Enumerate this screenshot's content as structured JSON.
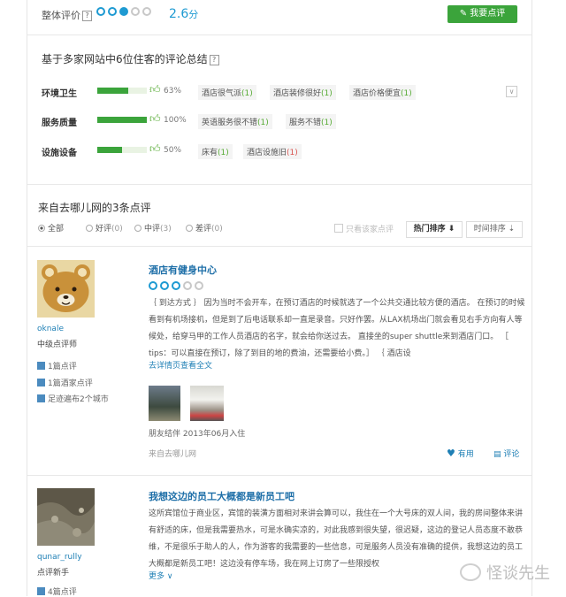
{
  "rating": {
    "label": "整体评价",
    "help": "?",
    "score": "2.6",
    "unit": "分",
    "stars_filled": 2.5,
    "stars_total": 5,
    "write_review_button": "我要点评"
  },
  "summary": {
    "title": "基于多家网站中6位住客的评论总结",
    "help": "?",
    "categories": [
      {
        "name": "环境卫生",
        "percent_text": "63%",
        "percent": 63,
        "tags": [
          {
            "text": "酒店很气派",
            "count": "(1)"
          },
          {
            "text": "酒店装修很好",
            "count": "(1)"
          },
          {
            "text": "酒店价格便宜",
            "count": "(1)"
          }
        ]
      },
      {
        "name": "服务质量",
        "percent_text": "100%",
        "percent": 100,
        "tags": [
          {
            "text": "英语服务很不错",
            "count": "(1)"
          },
          {
            "text": "服务不错",
            "count": "(1)"
          }
        ]
      },
      {
        "name": "设施设备",
        "percent_text": "50%",
        "percent": 50,
        "tags": [
          {
            "text": "床有",
            "count": "(1)"
          },
          {
            "text": "酒店设施旧",
            "count": "(1)"
          }
        ]
      }
    ]
  },
  "reviews_section": {
    "title": "来自去哪儿网的3条点评",
    "filters": [
      {
        "label": "全部",
        "count": ""
      },
      {
        "label": "好评",
        "count": "(0)"
      },
      {
        "label": "中评",
        "count": "(3)"
      },
      {
        "label": "差评",
        "count": "(0)"
      }
    ],
    "only_checkbox": "只看该家点评",
    "sort_hot": "热门排序",
    "sort_time": "时间排序"
  },
  "reviews": [
    {
      "username": "oknale",
      "level": "中级点评师",
      "stats": [
        "1篇点评",
        "1篇酒家点评",
        "足迹遍布2个城市"
      ],
      "title": "酒店有健身中心",
      "rating": 3,
      "text": "｛ 到达方式 ｝ 因为当时不会开车，在预订酒店的时候就选了一个公共交通比较方便的酒店。 在预订的时候看到有机场接机，但是到了后电话联系却一直是录音。只好作罢。从LAX机场出门就会看见右手方向有人等候处，给穿马甲的工作人员酒店的名字，就会给你送过去。 直接坐的super shuttle来到酒店门口。 ［ tips：可以直接在预订，除了到目的地的费油，还需要给小费。］ ｛ 酒店设",
      "read_more": "去详情页查看全文",
      "traveler": "朋友结伴 2013年06月入住",
      "source": "来自去哪儿网",
      "useful": "有用",
      "comment": "评论"
    },
    {
      "username": "qunar_rully",
      "level": "点评新手",
      "stats": [
        "4篇点评"
      ],
      "title": "我想这边的员工大概都是新员工吧",
      "text": "这所宾馆位于商业区，宾馆的装潢方面相对来讲会算可以，我住在一个大号床的双人间，我的房间整体来讲有舒适的床，但是我需要热水，可是水确实凉的，对此我感到很失望，很迟疑，这边的登记人员态度不敢恭维，不是很乐于助人的人，作为游客的我需要的一些信息，可是服务人员没有准确的提供，我想这边的员工大概都是新员工吧！这边没有停车场，我在网上订房了一些限授权",
      "more": "更多"
    }
  ],
  "watermark": "怪谈先生"
}
